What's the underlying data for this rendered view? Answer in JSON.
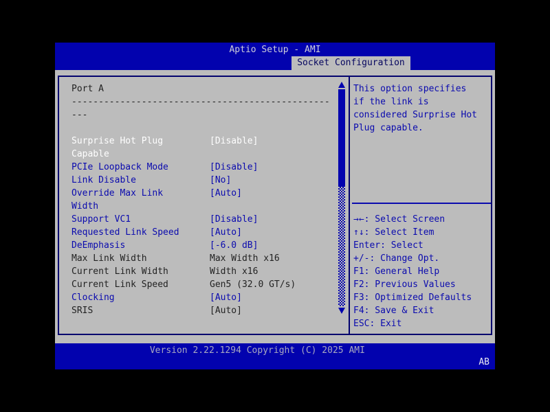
{
  "header": {
    "title": "Aptio Setup - AMI",
    "tab": "Socket Configuration"
  },
  "menu": {
    "section_title": "Port A",
    "separator_line1": "------------------------------------------------",
    "separator_line2": "---",
    "items": [
      {
        "label": [
          "Surprise Hot Plug",
          "Capable"
        ],
        "value": "[Disable]",
        "state": "selected"
      },
      {
        "label": [
          "PCIe Loopback Mode"
        ],
        "value": "[Disable]",
        "state": "editable"
      },
      {
        "label": [
          "Link Disable"
        ],
        "value": "[No]",
        "state": "editable"
      },
      {
        "label": [
          "Override Max Link",
          "Width"
        ],
        "value": "[Auto]",
        "state": "editable"
      },
      {
        "label": [
          "Support VC1"
        ],
        "value": "[Disable]",
        "state": "editable"
      },
      {
        "label": [
          "Requested Link Speed"
        ],
        "value": "[Auto]",
        "state": "editable"
      },
      {
        "label": [
          "DeEmphasis"
        ],
        "value": "[-6.0 dB]",
        "state": "editable"
      },
      {
        "label": [
          "Max Link Width"
        ],
        "value": "Max Width x16",
        "state": "readonly"
      },
      {
        "label": [
          "Current Link Width"
        ],
        "value": "Width x16",
        "state": "readonly"
      },
      {
        "label": [
          "Current Link Speed"
        ],
        "value": "Gen5 (32.0 GT/s)",
        "state": "readonly"
      },
      {
        "label": [
          "Clocking"
        ],
        "value": "[Auto]",
        "state": "editable"
      },
      {
        "label": [
          "SRIS"
        ],
        "value": "[Auto]",
        "state": "readonly"
      }
    ]
  },
  "help": {
    "text_lines": [
      "This option specifies",
      "if the link is",
      "considered Surprise Hot",
      "Plug capable."
    ],
    "hotkeys": [
      {
        "keys": "→←",
        "action": "Select Screen"
      },
      {
        "keys": "↑↓",
        "action": "Select Item"
      },
      {
        "keys": "Enter",
        "action": "Select"
      },
      {
        "keys": "+/-",
        "action": "Change Opt."
      },
      {
        "keys": "F1",
        "action": "General Help"
      },
      {
        "keys": "F2",
        "action": "Previous Values"
      },
      {
        "keys": "F3",
        "action": "Optimized Defaults"
      },
      {
        "keys": "F4",
        "action": "Save & Exit"
      },
      {
        "keys": "ESC",
        "action": "Exit"
      }
    ]
  },
  "footer": {
    "version_text": "Version 2.22.1294 Copyright (C) 2025 AMI",
    "badge": "AB"
  },
  "colors": {
    "bar_blue": "#0202ae",
    "panel_gray": "#bcbcbc",
    "border_navy": "#01016e",
    "item_blue": "#0a0aae",
    "selected_white": "#ffffff",
    "readonly_dark": "#222222",
    "title_text": "#cfcfdb"
  }
}
